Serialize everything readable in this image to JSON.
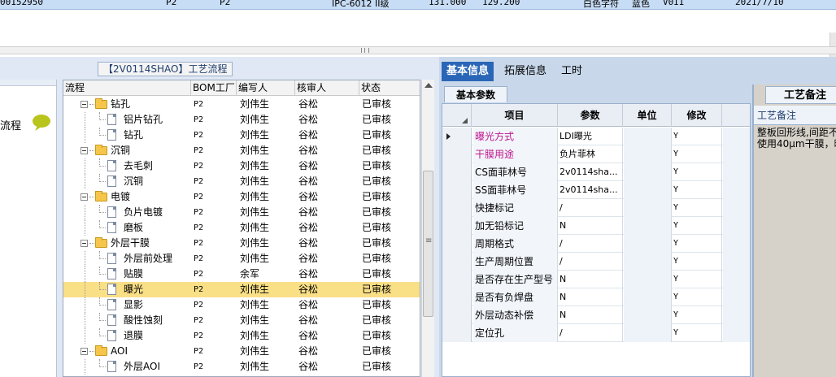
{
  "top_row": {
    "id": "00152950",
    "f1": "P2",
    "f2": "P2",
    "f3": "IPC-6012 II级",
    "f4": "131.000",
    "f5": "129.200",
    "f6": "白色字符",
    "f7": "蓝色",
    "f8": "V0II",
    "f9": "2021/7/10"
  },
  "flow_title": "【2V0114SHAO】工艺流程",
  "left_strip_label": "流程",
  "tree": {
    "headers": {
      "flow": "流程",
      "bom": "BOM工厂",
      "writer": "编写人",
      "reviewer": "核审人",
      "status": "状态"
    },
    "rows": [
      {
        "name": "钻孔",
        "bom": "P2",
        "writer": "刘伟生",
        "reviewer": "谷松",
        "status": "已审核",
        "type": "folder"
      },
      {
        "name": "铝片钻孔",
        "bom": "P2",
        "writer": "刘伟生",
        "reviewer": "谷松",
        "status": "已审核",
        "type": "doc"
      },
      {
        "name": "钻孔",
        "bom": "P2",
        "writer": "刘伟生",
        "reviewer": "谷松",
        "status": "已审核",
        "type": "doc"
      },
      {
        "name": "沉铜",
        "bom": "P2",
        "writer": "刘伟生",
        "reviewer": "谷松",
        "status": "已审核",
        "type": "folder"
      },
      {
        "name": "去毛刺",
        "bom": "P2",
        "writer": "刘伟生",
        "reviewer": "谷松",
        "status": "已审核",
        "type": "doc"
      },
      {
        "name": "沉铜",
        "bom": "P2",
        "writer": "刘伟生",
        "reviewer": "谷松",
        "status": "已审核",
        "type": "doc"
      },
      {
        "name": "电镀",
        "bom": "P2",
        "writer": "刘伟生",
        "reviewer": "谷松",
        "status": "已审核",
        "type": "folder"
      },
      {
        "name": "负片电镀",
        "bom": "P2",
        "writer": "刘伟生",
        "reviewer": "谷松",
        "status": "已审核",
        "type": "doc"
      },
      {
        "name": "磨板",
        "bom": "P2",
        "writer": "刘伟生",
        "reviewer": "谷松",
        "status": "已审核",
        "type": "doc"
      },
      {
        "name": "外层干膜",
        "bom": "P2",
        "writer": "刘伟生",
        "reviewer": "谷松",
        "status": "已审核",
        "type": "folder"
      },
      {
        "name": "外层前处理",
        "bom": "P2",
        "writer": "刘伟生",
        "reviewer": "谷松",
        "status": "已审核",
        "type": "doc"
      },
      {
        "name": "贴膜",
        "bom": "P2",
        "writer": "余军",
        "reviewer": "谷松",
        "status": "已审核",
        "type": "doc"
      },
      {
        "name": "曝光",
        "bom": "P2",
        "writer": "刘伟生",
        "reviewer": "谷松",
        "status": "已审核",
        "type": "doc",
        "selected": true
      },
      {
        "name": "显影",
        "bom": "P2",
        "writer": "刘伟生",
        "reviewer": "谷松",
        "status": "已审核",
        "type": "doc"
      },
      {
        "name": "酸性蚀刻",
        "bom": "P2",
        "writer": "刘伟生",
        "reviewer": "谷松",
        "status": "已审核",
        "type": "doc"
      },
      {
        "name": "退膜",
        "bom": "P2",
        "writer": "刘伟生",
        "reviewer": "谷松",
        "status": "已审核",
        "type": "doc"
      },
      {
        "name": "AOI",
        "bom": "P2",
        "writer": "刘伟生",
        "reviewer": "谷松",
        "status": "已审核",
        "type": "folder"
      },
      {
        "name": "外层AOI",
        "bom": "P2",
        "writer": "刘伟生",
        "reviewer": "谷松",
        "status": "已审核",
        "type": "doc"
      }
    ]
  },
  "tabs": [
    "基本信息",
    "拓展信息",
    "工时"
  ],
  "subtab": "基本参数",
  "grid": {
    "headers": {
      "item": "项目",
      "param": "参数",
      "unit": "单位",
      "modify": "修改"
    },
    "rows": [
      {
        "item": "曝光方式",
        "param": "LDI曝光",
        "unit": "",
        "modify": "Y",
        "highlight": true
      },
      {
        "item": "干膜用途",
        "param": "负片菲林",
        "unit": "",
        "modify": "Y",
        "highlight": true
      },
      {
        "item": "CS面菲林号",
        "param": "2v0114sha...",
        "unit": "",
        "modify": "Y"
      },
      {
        "item": "SS面菲林号",
        "param": "2v0114sha...",
        "unit": "",
        "modify": "Y"
      },
      {
        "item": "快捷标记",
        "param": "/",
        "unit": "",
        "modify": "Y"
      },
      {
        "item": "加无铅标记",
        "param": "N",
        "unit": "",
        "modify": "Y"
      },
      {
        "item": "周期格式",
        "param": "/",
        "unit": "",
        "modify": "Y"
      },
      {
        "item": "生产周期位置",
        "param": "/",
        "unit": "",
        "modify": "Y"
      },
      {
        "item": "是否存在生产型号",
        "param": "N",
        "unit": "",
        "modify": "Y"
      },
      {
        "item": "是否有负焊盘",
        "param": "N",
        "unit": "",
        "modify": "Y"
      },
      {
        "item": "外层动态补偿",
        "param": "N",
        "unit": "",
        "modify": "Y"
      },
      {
        "item": "定位孔",
        "param": "/",
        "unit": "",
        "modify": "Y"
      }
    ]
  },
  "notes": {
    "tab": "工艺备注",
    "label": "工艺备注",
    "line1": "整板回形线,间距不",
    "line2": "使用40μm干膜，曝"
  },
  "colors": {
    "tab_active": "#2a66b7",
    "selected_row": "#f9df86",
    "highlight_text": "#c0158b"
  }
}
